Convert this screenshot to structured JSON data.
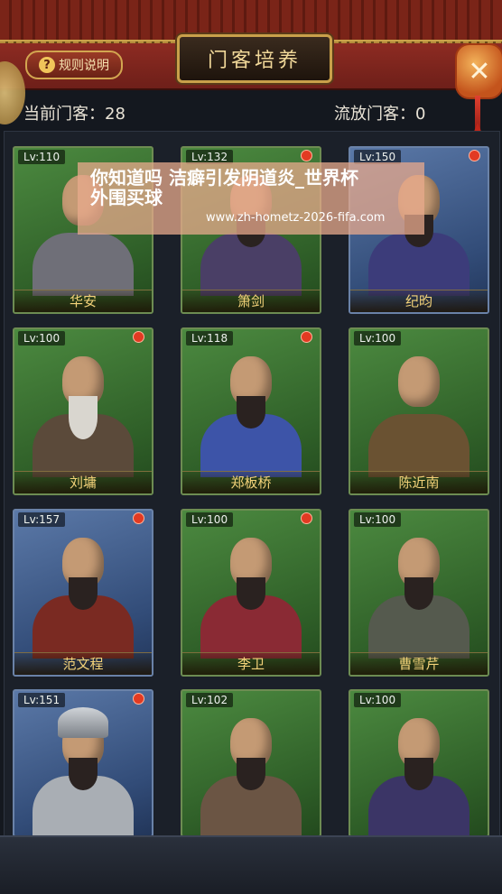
{
  "header": {
    "title": "门客培养",
    "rules_label": "规则说明",
    "rules_icon": "?",
    "close_icon": "✕"
  },
  "counts": {
    "current_label": "当前门客：",
    "current_value": "28",
    "exiled_label": "流放门客：",
    "exiled_value": "0"
  },
  "retainers": [
    {
      "level": "Lv:110",
      "name": "华安",
      "dot": false,
      "bg": "green"
    },
    {
      "level": "Lv:132",
      "name": "箫剑",
      "dot": true,
      "bg": "green"
    },
    {
      "level": "Lv:150",
      "name": "纪昀",
      "dot": true,
      "bg": "blue"
    },
    {
      "level": "Lv:100",
      "name": "刘墉",
      "dot": true,
      "bg": "green"
    },
    {
      "level": "Lv:118",
      "name": "郑板桥",
      "dot": true,
      "bg": "green"
    },
    {
      "level": "Lv:100",
      "name": "陈近南",
      "dot": false,
      "bg": "green"
    },
    {
      "level": "Lv:157",
      "name": "范文程",
      "dot": true,
      "bg": "blue"
    },
    {
      "level": "Lv:100",
      "name": "李卫",
      "dot": true,
      "bg": "green"
    },
    {
      "level": "Lv:100",
      "name": "曹雪芹",
      "dot": false,
      "bg": "green"
    },
    {
      "level": "Lv:151",
      "name": "",
      "dot": true,
      "bg": "blue"
    },
    {
      "level": "Lv:102",
      "name": "",
      "dot": false,
      "bg": "green"
    },
    {
      "level": "Lv:100",
      "name": "",
      "dot": false,
      "bg": "green"
    }
  ],
  "overlay": {
    "line1": "你知道吗  洁癖引发阴道炎_世界杯",
    "line2": "外围买球",
    "url": "www.zh-hometz-2026-fifa.com"
  },
  "colors": {
    "header_red": "#8d2b22",
    "gold": "#c9a04a",
    "card_green": "#4c8a40",
    "card_blue": "#5b79a8",
    "badge_red": "#e23a22"
  }
}
